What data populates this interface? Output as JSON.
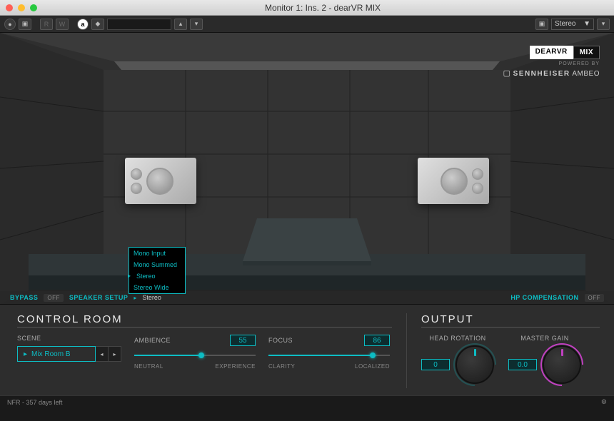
{
  "window": {
    "title": "Monitor 1: Ins. 2 - dearVR MIX"
  },
  "hostbar": {
    "stereo": "Stereo"
  },
  "branding": {
    "dear": "DEARVR",
    "mix": "MIX",
    "powered": "POWERED BY",
    "senn_brand": "SENNHEISER",
    "senn_sub": "AMBEO"
  },
  "speaker_menu": {
    "items": [
      "Mono Input",
      "Mono Summed",
      "Stereo",
      "Stereo Wide"
    ],
    "selected": "Stereo"
  },
  "utilstrip": {
    "bypass_label": "BYPASS",
    "bypass_state": "OFF",
    "speaker_setup_label": "SPEAKER SETUP",
    "speaker_setup_value": "Stereo",
    "hp_label": "HP COMPENSATION",
    "hp_state": "OFF"
  },
  "control_room": {
    "title": "CONTROL ROOM",
    "scene_label": "SCENE",
    "scene_value": "Mix Room B",
    "ambience": {
      "label": "AMBIENCE",
      "value": "55",
      "left": "NEUTRAL",
      "right": "EXPERIENCE",
      "pct": 55
    },
    "focus": {
      "label": "FOCUS",
      "value": "86",
      "left": "CLARITY",
      "right": "LOCALIZED",
      "pct": 86
    }
  },
  "output": {
    "title": "OUTPUT",
    "head_rotation_label": "HEAD ROTATION",
    "head_rotation_value": "0",
    "master_gain_label": "MASTER GAIN",
    "master_gain_value": "0.0"
  },
  "status": {
    "text": "NFR - 357 days left"
  }
}
